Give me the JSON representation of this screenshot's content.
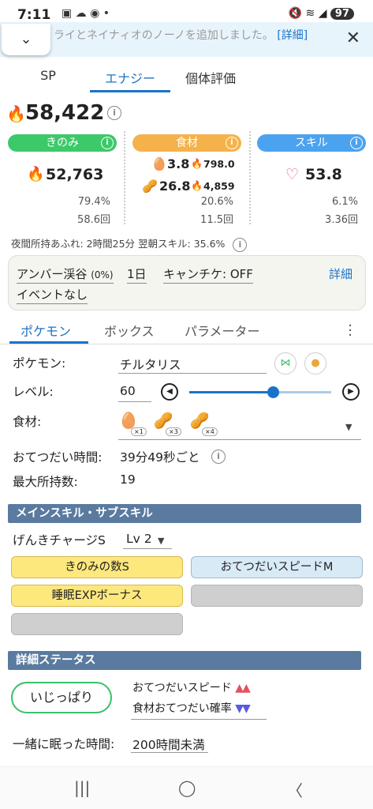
{
  "status_bar": {
    "time": "7:11",
    "battery": "97"
  },
  "notice": {
    "text": "ライとネイナィオのノーノを追加しました。",
    "link": "[詳細]"
  },
  "tabs": [
    "SP",
    "エナジー",
    "個体評価"
  ],
  "energy": {
    "total": "58,422",
    "berry": {
      "label": "きのみ",
      "value": "52,763",
      "percent": "79.4%",
      "count": "58.6回"
    },
    "ingredient": {
      "label": "食材",
      "item1_qty": "3.8",
      "item1_energy": "798.0",
      "item2_qty": "26.8",
      "item2_energy": "4,859",
      "percent": "20.6%",
      "count": "11.5回"
    },
    "skill": {
      "label": "スキル",
      "value": "53.8",
      "percent": "6.1%",
      "count": "3.36回"
    },
    "colors": {
      "berry": "#3cc96a",
      "ingredient": "#f5b24a",
      "skill": "#4ba3ef"
    }
  },
  "night_info": "夜間所持あふれ: 2時間25分  翌朝スキル: 35.6%",
  "settings": {
    "area": "アンバー渓谷",
    "area_bonus": "(0%)",
    "days": "1日",
    "candy": "キャンチケ: OFF",
    "detail": "詳細",
    "event": "イベントなし"
  },
  "subtabs": [
    "ポケモン",
    "ボックス",
    "パラメーター"
  ],
  "pokemon": {
    "pokemon_label": "ポケモン:",
    "pokemon_name": "チルタリス",
    "level_label": "レベル:",
    "level_value": "60",
    "level_fraction": 0.59,
    "ingredients_label": "食材:",
    "ingredients": [
      {
        "icon": "egg-icon",
        "count": "×1"
      },
      {
        "icon": "soybean-icon",
        "count": "×3"
      },
      {
        "icon": "soybean-icon",
        "count": "×4"
      }
    ],
    "help_time_label": "おてつだい時間:",
    "help_time_value": "39分49秒ごと",
    "max_carry_label": "最大所持数:",
    "max_carry_value": "19"
  },
  "skills": {
    "section_title": "メインスキル・サブスキル",
    "main_skill": "げんきチャージS",
    "main_skill_level": "Lv 2",
    "sub_skills": [
      "きのみの数S",
      "おてつだいスピードM",
      "睡眠EXPボーナス",
      "",
      ""
    ]
  },
  "status": {
    "section_title": "詳細ステータス",
    "nature": "いじっぱり",
    "up_label": "おてつだいスピード",
    "up_marks": "▲▲",
    "down_label": "食材おてつだい確率",
    "down_marks": "▼▼",
    "sleep_label": "一緒に眠った時間:",
    "sleep_value": "200時間未満"
  }
}
